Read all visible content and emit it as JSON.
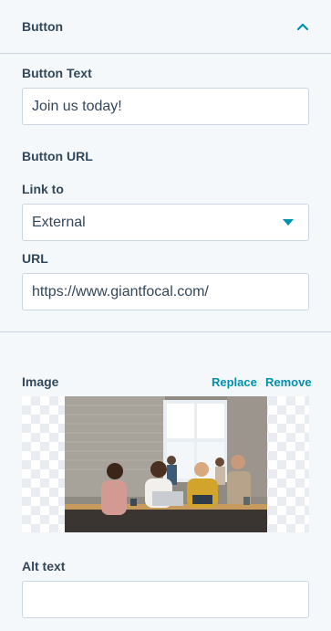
{
  "section": {
    "title": "Button",
    "toggle_icon": "chevron-up-icon"
  },
  "button_text": {
    "label": "Button Text",
    "value": "Join us today!"
  },
  "button_url": {
    "label": "Button URL"
  },
  "link_to": {
    "label": "Link to",
    "selected": "External",
    "icon": "caret-down-icon"
  },
  "url": {
    "label": "URL",
    "value": "https://www.giantfocal.com/"
  },
  "image": {
    "label": "Image",
    "replace_label": "Replace",
    "remove_label": "Remove"
  },
  "alt_text": {
    "label": "Alt text",
    "value": ""
  },
  "colors": {
    "accent": "#0091ae",
    "text": "#33475b",
    "border": "#cbd6e2",
    "panel": "#f5f8fa"
  }
}
